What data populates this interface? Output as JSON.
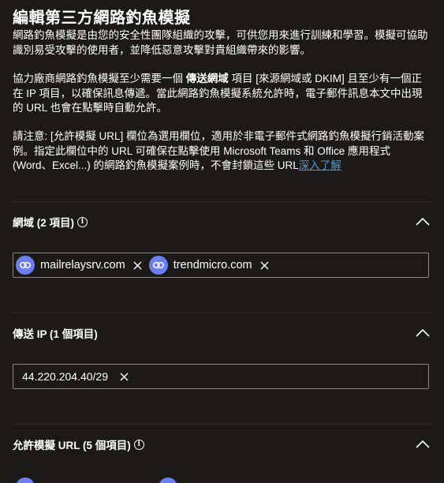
{
  "page": {
    "title": "編輯第三方網路釣魚模擬",
    "intro_1": "網路釣魚模擬是由您的安全性團隊組織的攻擊，可供您用來進行訓練和學習。模擬可協助識別易受攻擊的使用者，並降低惡意攻擊對貴組織帶來的影響。",
    "intro_2_before": "協力廠商網路釣魚模擬至少需要一個 ",
    "intro_2_bold": "傳送網域",
    "intro_2_after": " 項目 [來源網域或 DKIM] 且至少有一個正在 IP 項目，以確保訊息傳遞。當此網路釣魚模擬系統允許時，電子郵件訊息本文中出現的 URL 也會在點擊時自動允許。",
    "intro_3": "請注意: [允許模擬 URL] 欄位為選用欄位，適用於非電子郵件式網路釣魚模擬行銷活動案例。指定此欄位中的 URL 可確保在點擊使用 Microsoft Teams 和 Office 應用程式 (Word、Excel...) 的網路釣魚模擬案例時，不會封鎖這些 URL",
    "learn_more": "深入了解"
  },
  "domains": {
    "title": "網域 (2 項目)",
    "items": [
      "mailrelaysrv.com",
      "trendmicro.com"
    ]
  },
  "sending_ip": {
    "title": "傳送 IP (1 個項目)",
    "items": [
      "44.220.204.40/29"
    ]
  },
  "simulation_urls": {
    "title": "允許模擬 URL (5 個項目)"
  },
  "colors": {
    "background": "#1b1a19",
    "link": "#4f9bd9",
    "chip_avatar": "#6b7ff0",
    "border": "#8a8886"
  },
  "icons": {
    "info": "info-icon",
    "collapse": "chevron-up-icon",
    "remove": "close-icon",
    "domain_avatar": "link-icon"
  }
}
